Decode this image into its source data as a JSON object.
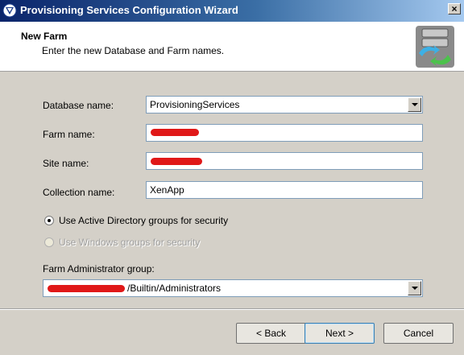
{
  "window": {
    "title": "Provisioning Services Configuration Wizard",
    "close_label": "×"
  },
  "header": {
    "title": "New Farm",
    "subtitle": "Enter the new Database and Farm names."
  },
  "form": {
    "database_name_label": "Database name:",
    "database_name_value": "ProvisioningServices",
    "farm_name_label": "Farm name:",
    "farm_name_value": "",
    "site_name_label": "Site name:",
    "site_name_value": "",
    "collection_name_label": "Collection name:",
    "collection_name_value": "XenApp",
    "radio_ad_label": "Use Active Directory groups for security",
    "radio_ad_checked": true,
    "radio_windows_label": "Use Windows groups for security",
    "radio_windows_enabled": false,
    "farm_admin_group_label": "Farm Administrator group:",
    "farm_admin_group_value": "/Builtin/Administrators"
  },
  "buttons": {
    "back": "< Back",
    "next": "Next >",
    "cancel": "Cancel"
  },
  "icons": {
    "app": "citrix-wizard-icon",
    "header": "server-refresh-icon",
    "combo": "chevron-down-icon"
  },
  "colors": {
    "title_bar_start": "#0a246a",
    "title_bar_end": "#a6caf0",
    "redaction": "#e01818",
    "dialog_bg": "#d4d0c8"
  }
}
